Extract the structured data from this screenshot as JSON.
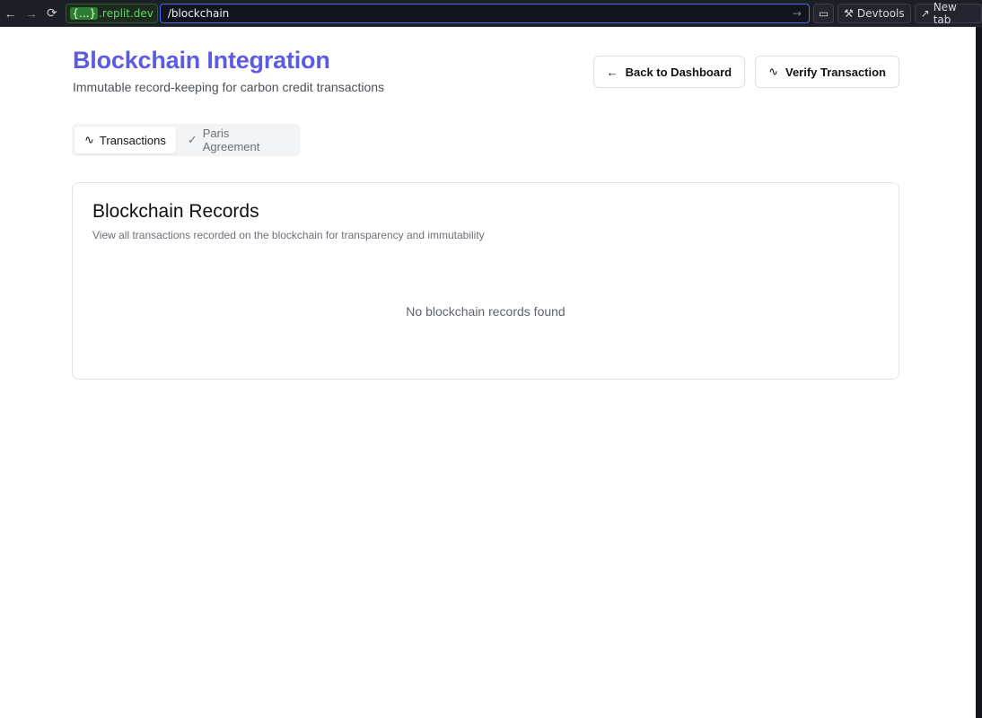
{
  "browser": {
    "back_icon": "←",
    "forward_icon": "→",
    "reload_icon": "⟳",
    "domain_braces": "{...}",
    "domain_suffix": ".replit.dev",
    "url_path": "/blockchain",
    "go_icon": "→",
    "screen_icon": "▭",
    "devtools_label": "Devtools",
    "devtools_icon": "⚒",
    "new_tab_label": "New tab",
    "new_tab_icon": "↗"
  },
  "header": {
    "title": "Blockchain Integration",
    "subtitle": "Immutable record-keeping for carbon credit transactions",
    "back_button": {
      "icon": "←",
      "label": "Back to Dashboard"
    },
    "verify_button": {
      "icon": "∿",
      "label": "Verify Transaction"
    }
  },
  "tabs": [
    {
      "icon": "∿",
      "label": "Transactions",
      "active": true
    },
    {
      "icon": "✓",
      "label": "Paris Agreement",
      "active": false
    }
  ],
  "card": {
    "title": "Blockchain Records",
    "description": "View all transactions recorded on the blockchain for transparency and immutability",
    "empty_message": "No blockchain records found"
  },
  "colors": {
    "accent": "#5b5ce2",
    "url_border": "#4a6cf0",
    "domain_green": "#5cd66a"
  }
}
